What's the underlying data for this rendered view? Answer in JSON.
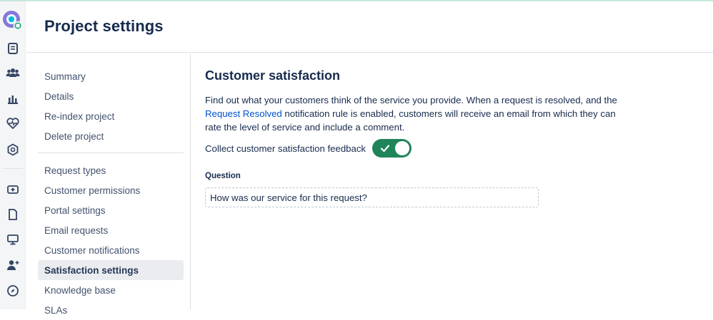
{
  "header": {
    "title": "Project settings"
  },
  "sidebar": {
    "items": [
      {
        "label": "Summary",
        "active": false
      },
      {
        "label": "Details",
        "active": false
      },
      {
        "label": "Re-index project",
        "active": false
      },
      {
        "label": "Delete project",
        "active": false
      },
      {
        "label": "Request types",
        "active": false
      },
      {
        "label": "Customer permissions",
        "active": false
      },
      {
        "label": "Portal settings",
        "active": false
      },
      {
        "label": "Email requests",
        "active": false
      },
      {
        "label": "Customer notifications",
        "active": false
      },
      {
        "label": "Satisfaction settings",
        "active": true
      },
      {
        "label": "Knowledge base",
        "active": false
      },
      {
        "label": "SLAs",
        "active": false
      }
    ]
  },
  "rail": {
    "icons": [
      "project-avatar-icon",
      "queues-icon",
      "customers-icon",
      "reports-icon",
      "service-health-icon",
      "components-icon",
      "add-item-icon",
      "pages-icon",
      "display-icon",
      "add-people-icon",
      "compass-icon"
    ]
  },
  "main": {
    "title": "Customer satisfaction",
    "description_part1": "Find out what your customers think of the service you provide. When a request is resolved, and the ",
    "description_link": "Request Resolved",
    "description_part2": " notification rule is enabled, customers will receive an email from which they can rate the level of service and include a comment.",
    "toggle_label": "Collect customer satisfaction feedback",
    "toggle_on": true,
    "question_label": "Question",
    "question_value": "How was our service for this request?"
  },
  "colors": {
    "toggle_on": "#1f845a",
    "link": "#0052cc",
    "active_nav_bg": "#ebecf0"
  }
}
